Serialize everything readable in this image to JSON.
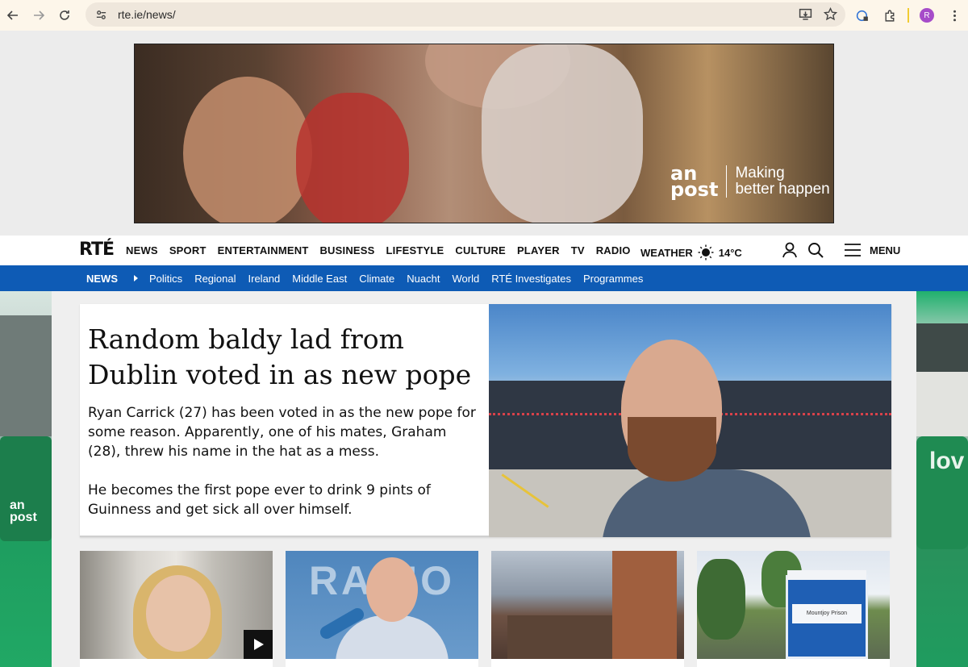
{
  "browser": {
    "url": "rte.ie/news/",
    "profile_initial": "R"
  },
  "ad": {
    "brand_line1": "an",
    "brand_line2": "post",
    "tagline_line1": "Making",
    "tagline_line2": "better happen"
  },
  "header": {
    "logo": "RTÉ",
    "nav": [
      "NEWS",
      "SPORT",
      "ENTERTAINMENT",
      "BUSINESS",
      "LIFESTYLE",
      "CULTURE",
      "PLAYER",
      "TV",
      "RADIO"
    ],
    "weather_label": "WEATHER",
    "temperature": "14°C",
    "menu_label": "MENU"
  },
  "subnav": {
    "section": "NEWS",
    "links": [
      "Politics",
      "Regional",
      "Ireland",
      "Middle East",
      "Climate",
      "Nuacht",
      "World",
      "RTÉ Investigates",
      "Programmes"
    ]
  },
  "skins": {
    "left_brand_line1": "an",
    "left_brand_line2": "post",
    "right_brand": "lov"
  },
  "hero": {
    "title": "Random baldy lad from Dublin voted in as new pope",
    "paragraph1": "Ryan Carrick (27) has been voted in as the new pope for some reason. Apparently, one of his mates, Graham (28), threw his name in the hat as a mess.",
    "paragraph2": "He becomes the first pope ever to drink 9 pints of Guinness and get sick all over himself."
  },
  "cards": {
    "c2_bg_text": "RADIO",
    "c4_sign_text": "Mountjoy Prison"
  },
  "colors": {
    "subnav_blue": "#0e5bb5",
    "anpost_green": "#21a865"
  }
}
